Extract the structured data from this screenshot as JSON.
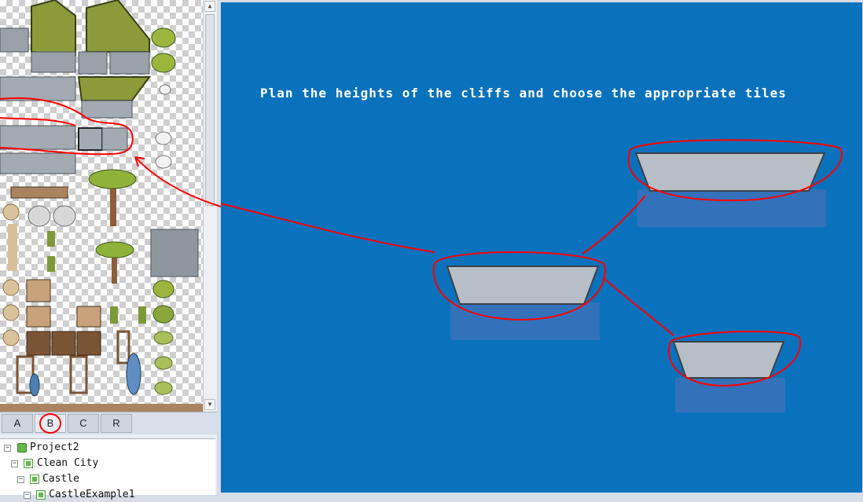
{
  "tileset_tabs": [
    {
      "label": "A",
      "selected": false
    },
    {
      "label": "B",
      "selected": true
    },
    {
      "label": "C",
      "selected": false
    },
    {
      "label": "R",
      "selected": false
    }
  ],
  "project_tree": {
    "nodes": [
      {
        "label": "Project2",
        "icon": "project-icon",
        "expanded": true,
        "depth": 0
      },
      {
        "label": "Clean City",
        "icon": "map-icon",
        "expanded": true,
        "depth": 1
      },
      {
        "label": "Castle",
        "icon": "map-icon",
        "expanded": true,
        "depth": 2
      },
      {
        "label": "CastleExample1",
        "icon": "map-icon",
        "expanded": true,
        "depth": 3
      }
    ]
  },
  "map_canvas": {
    "annotation_text": "Plan the heights of the cliffs and choose the appropriate tiles",
    "background_color": "#0a72bd",
    "annotation_color": "#ff0000"
  }
}
